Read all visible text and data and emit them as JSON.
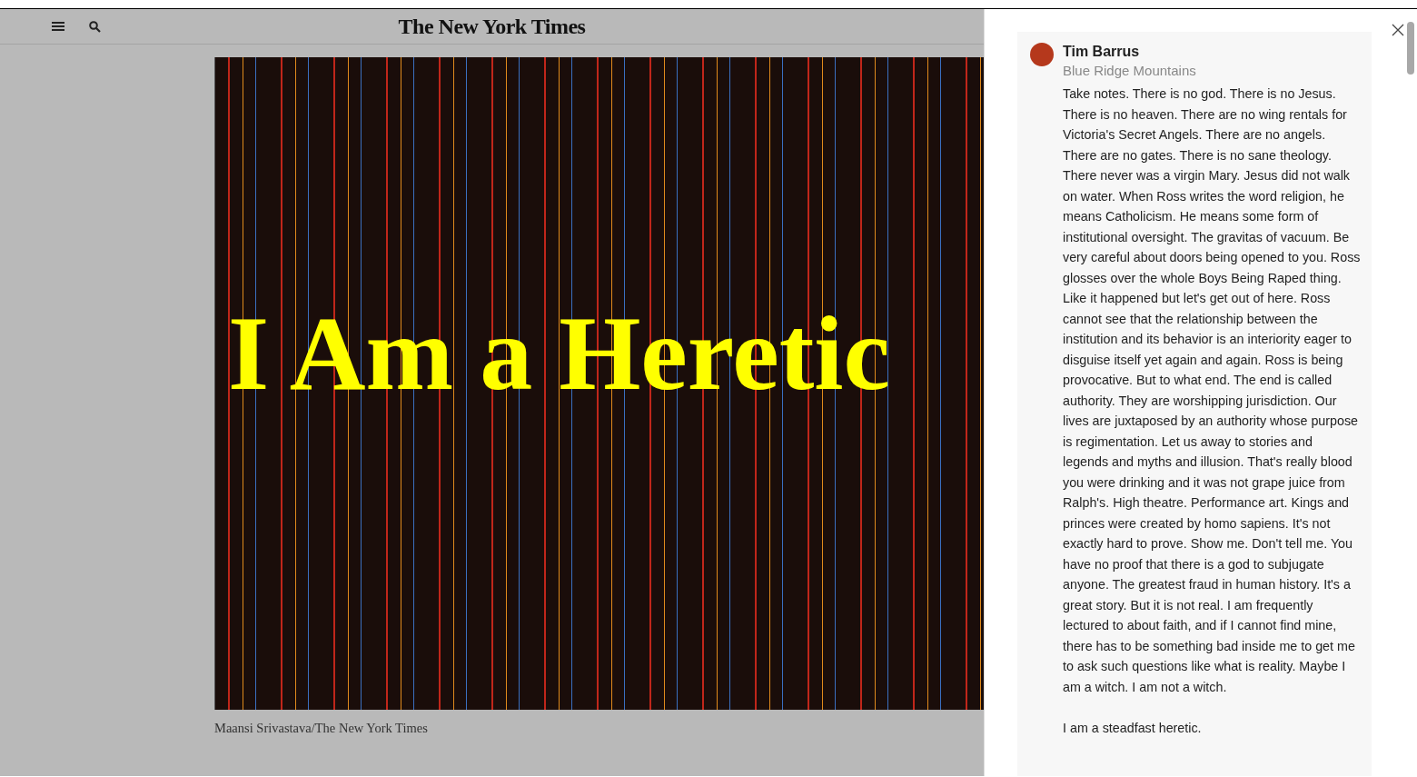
{
  "header": {
    "logo": "The New York Times"
  },
  "article": {
    "headline_overlay": "I Am a Heretic",
    "photo_credit": "Maansi Srivastava/The New York Times"
  },
  "comment": {
    "author": "Tim Barrus",
    "location": "Blue Ridge Mountains",
    "paragraphs": [
      "Take notes. There is no god. There is no Jesus. There is no heaven. There are no wing rentals for Victoria's Secret Angels. There are no angels. There are no gates. There is no sane theology. There never was a virgin Mary. Jesus did not walk on water. When Ross writes the word religion, he means Catholicism. He means some form of institutional oversight. The gravitas of vacuum. Be very careful about doors being opened to you. Ross glosses over the whole Boys Being Raped thing. Like it happened but let's get out of here. Ross cannot see that the relationship between the institution and its behavior is an interiority eager to disguise itself yet again and again. Ross is being provocative. But to what end. The end is called authority. They are worshipping jurisdiction. Our lives are juxtaposed by an authority whose purpose is regimentation. Let us away to stories and legends and myths and illusion. That's really blood you were drinking and it was not grape juice from Ralph's. High theatre. Performance art. Kings and princes were created by homo sapiens. It's not exactly hard to prove. Show me. Don't tell me. You have no proof that there is a god to subjugate anyone. The greatest fraud in human history. It's a great story. But it is not real. I am frequently lectured to about faith, and if I cannot find mine, there has to be something bad inside me to get me to ask such questions like what is reality. Maybe I am a witch. I am not a witch.",
      "I am a steadfast heretic."
    ]
  }
}
